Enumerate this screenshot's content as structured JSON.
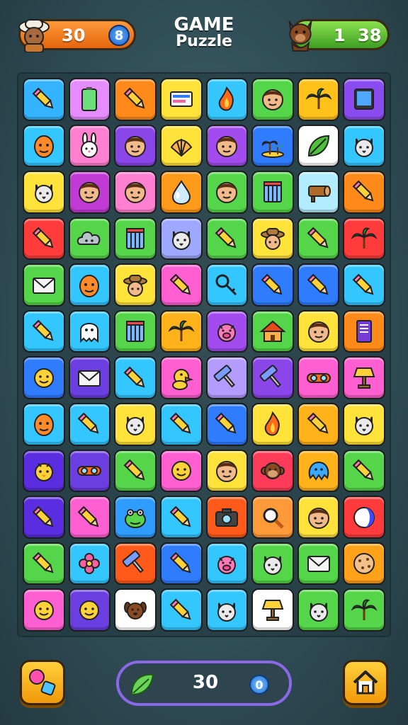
{
  "header": {
    "title_line1": "GAME",
    "title_line2": "Puzzle",
    "player1": {
      "score": "30",
      "badge": "8",
      "avatar": "explorer-avatar-icon",
      "color": "#f07a1a"
    },
    "player2": {
      "score_a": "1",
      "score_b": "38",
      "avatar": "squirrel-avatar-icon",
      "color": "#5cc235"
    }
  },
  "board": {
    "columns": 8,
    "rows": 12,
    "tiles": [
      [
        {
          "bg": "#34b4ff",
          "icon": "pencil"
        },
        {
          "bg": "#e58cff",
          "icon": "battery"
        },
        {
          "bg": "#ff8a1a",
          "icon": "pencil"
        },
        {
          "bg": "#ffe23a",
          "icon": "card"
        },
        {
          "bg": "#36c7ff",
          "icon": "flame"
        },
        {
          "bg": "#55d64a",
          "icon": "face"
        },
        {
          "bg": "#ffc21a",
          "icon": "palm"
        },
        {
          "bg": "#8a4cf0",
          "icon": "tablet"
        }
      ],
      [
        {
          "bg": "#34c6ff",
          "icon": "mask"
        },
        {
          "bg": "#ff7fd0",
          "icon": "bunny"
        },
        {
          "bg": "#8a46e8",
          "icon": "face"
        },
        {
          "bg": "#ffe23a",
          "icon": "shell"
        },
        {
          "bg": "#a24cf0",
          "icon": "face"
        },
        {
          "bg": "#2f7cff",
          "icon": "island"
        },
        {
          "bg": "#ffffff",
          "icon": "leaf"
        },
        {
          "bg": "#34c6ff",
          "icon": "cat"
        }
      ],
      [
        {
          "bg": "#ffe23a",
          "icon": "cat"
        },
        {
          "bg": "#c23ad6",
          "icon": "face"
        },
        {
          "bg": "#ff7fd0",
          "icon": "face"
        },
        {
          "bg": "#ff9a1a",
          "icon": "drop"
        },
        {
          "bg": "#55d64a",
          "icon": "face"
        },
        {
          "bg": "#55d64a",
          "icon": "crate"
        },
        {
          "bg": "#b4ecff",
          "icon": "log"
        },
        {
          "bg": "#ff8a1a",
          "icon": "pencil"
        }
      ],
      [
        {
          "bg": "#ff3b3b",
          "icon": "pencil"
        },
        {
          "bg": "#55d64a",
          "icon": "cloud"
        },
        {
          "bg": "#55d64a",
          "icon": "crate"
        },
        {
          "bg": "#9ea8ff",
          "icon": "cat"
        },
        {
          "bg": "#55d64a",
          "icon": "pencil"
        },
        {
          "bg": "#ffe23a",
          "icon": "explorer"
        },
        {
          "bg": "#55d64a",
          "icon": "pencil"
        },
        {
          "bg": "#ff3b3b",
          "icon": "palm"
        }
      ],
      [
        {
          "bg": "#55d64a",
          "icon": "envelope"
        },
        {
          "bg": "#34c6ff",
          "icon": "mask"
        },
        {
          "bg": "#ffe23a",
          "icon": "explorer"
        },
        {
          "bg": "#ff5fd0",
          "icon": "pencil"
        },
        {
          "bg": "#34c6ff",
          "icon": "key"
        },
        {
          "bg": "#2f7cff",
          "icon": "pencil"
        },
        {
          "bg": "#2f7cff",
          "icon": "pencil"
        },
        {
          "bg": "#34c6ff",
          "icon": "pencil"
        }
      ],
      [
        {
          "bg": "#34c6ff",
          "icon": "pencil"
        },
        {
          "bg": "#34c6ff",
          "icon": "ghost"
        },
        {
          "bg": "#55d64a",
          "icon": "crate"
        },
        {
          "bg": "#ffb21a",
          "icon": "palm"
        },
        {
          "bg": "#a24cf0",
          "icon": "pig"
        },
        {
          "bg": "#55d64a",
          "icon": "house"
        },
        {
          "bg": "#ffe23a",
          "icon": "face"
        },
        {
          "bg": "#ff8a1a",
          "icon": "book"
        }
      ],
      [
        {
          "bg": "#2f7cff",
          "icon": "smile"
        },
        {
          "bg": "#6a3ee0",
          "icon": "envelope"
        },
        {
          "bg": "#34c6ff",
          "icon": "pencil"
        },
        {
          "bg": "#ff5fd0",
          "icon": "duck"
        },
        {
          "bg": "#b49cff",
          "icon": "roller"
        },
        {
          "bg": "#8a46e8",
          "icon": "roller"
        },
        {
          "bg": "#ff5fd0",
          "icon": "goggles"
        },
        {
          "bg": "#ff5fd0",
          "icon": "lamp"
        }
      ],
      [
        {
          "bg": "#34c6ff",
          "icon": "mask"
        },
        {
          "bg": "#34c6ff",
          "icon": "pencil"
        },
        {
          "bg": "#ffe23a",
          "icon": "cat"
        },
        {
          "bg": "#34c6ff",
          "icon": "pencil"
        },
        {
          "bg": "#2f7cff",
          "icon": "pencil"
        },
        {
          "bg": "#ffe23a",
          "icon": "flame"
        },
        {
          "bg": "#ffb21a",
          "icon": "pencil"
        },
        {
          "bg": "#ffe23a",
          "icon": "cat"
        }
      ],
      [
        {
          "bg": "#5a2ee0",
          "icon": "chick"
        },
        {
          "bg": "#6a3ee0",
          "icon": "goggles"
        },
        {
          "bg": "#55d64a",
          "icon": "pencil"
        },
        {
          "bg": "#ff5fd0",
          "icon": "smile"
        },
        {
          "bg": "#ffe23a",
          "icon": "face"
        },
        {
          "bg": "#ff3b5a",
          "icon": "monkey"
        },
        {
          "bg": "#ffb21a",
          "icon": "blob"
        },
        {
          "bg": "#55d64a",
          "icon": "pencil"
        }
      ],
      [
        {
          "bg": "#5a2ee0",
          "icon": "pencil"
        },
        {
          "bg": "#ff5fd0",
          "icon": "pencil"
        },
        {
          "bg": "#2f9cff",
          "icon": "frog"
        },
        {
          "bg": "#34c6ff",
          "icon": "pencil"
        },
        {
          "bg": "#ff5a1a",
          "icon": "camera"
        },
        {
          "bg": "#ff9a3a",
          "icon": "magnifier"
        },
        {
          "bg": "#ffe23a",
          "icon": "face"
        },
        {
          "bg": "#ff3b3b",
          "icon": "ball"
        }
      ],
      [
        {
          "bg": "#55d64a",
          "icon": "pencil"
        },
        {
          "bg": "#34c6ff",
          "icon": "flower"
        },
        {
          "bg": "#ff5a1a",
          "icon": "roller"
        },
        {
          "bg": "#2f7cff",
          "icon": "pencil"
        },
        {
          "bg": "#34c6ff",
          "icon": "pig"
        },
        {
          "bg": "#55d64a",
          "icon": "cat"
        },
        {
          "bg": "#55d64a",
          "icon": "envelope"
        },
        {
          "bg": "#ffa21a",
          "icon": "cookie"
        }
      ],
      [
        {
          "bg": "#ff5fd0",
          "icon": "smile"
        },
        {
          "bg": "#6a3ee0",
          "icon": "smile"
        },
        {
          "bg": "#ffffff",
          "icon": "dog"
        },
        {
          "bg": "#34c6ff",
          "icon": "pencil"
        },
        {
          "bg": "#34c6ff",
          "icon": "cat"
        },
        {
          "bg": "#ffffff",
          "icon": "lamp"
        },
        {
          "bg": "#55d64a",
          "icon": "cat"
        },
        {
          "bg": "#55d64a",
          "icon": "palm"
        }
      ]
    ]
  },
  "bottom": {
    "left_button": "shapes-icon",
    "counter_value": "30",
    "counter_icon": "0",
    "right_button": "home-icon"
  }
}
